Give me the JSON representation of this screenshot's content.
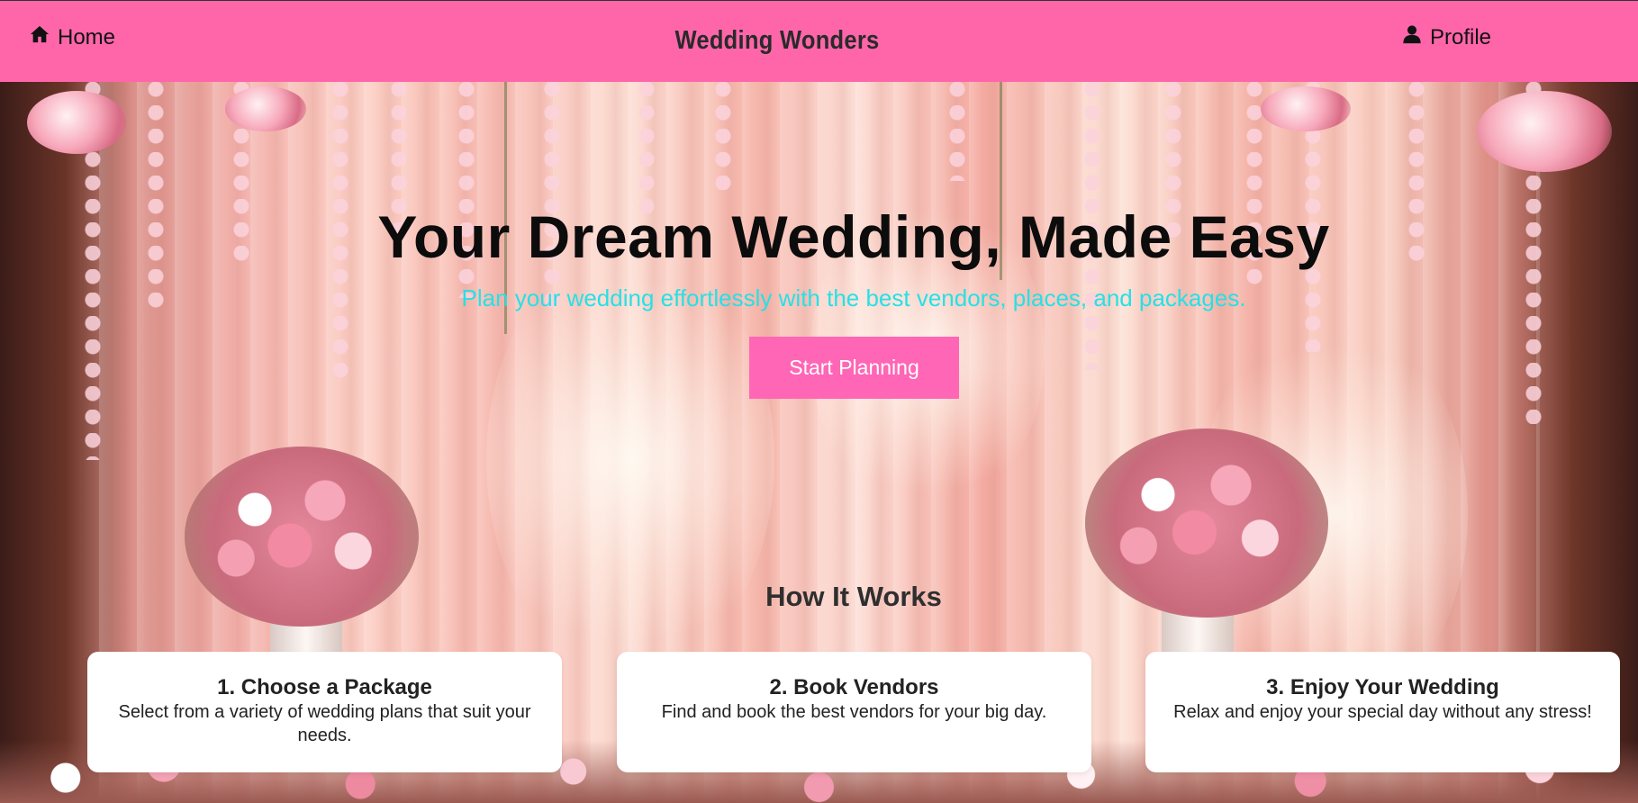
{
  "nav": {
    "home_label": "Home",
    "brand": "Wedding Wonders",
    "profile_label": "Profile"
  },
  "hero": {
    "title": "Your Dream Wedding, Made Easy",
    "subtitle": "Plan your wedding effortlessly with the best vendors, places, and packages.",
    "cta_label": "Start Planning"
  },
  "how_it_works": {
    "title": "How It Works",
    "steps": [
      {
        "title": "1. Choose a Package",
        "text": "Select from a variety of wedding plans that suit your needs."
      },
      {
        "title": "2. Book Vendors",
        "text": "Find and book the best vendors for your big day."
      },
      {
        "title": "3. Enjoy Your Wedding",
        "text": "Relax and enjoy your special day without any stress!"
      }
    ]
  },
  "colors": {
    "navbar": "#ff66aa",
    "cta": "#ff66b5",
    "subtitle": "#27e0e6"
  },
  "icons": {
    "home": "home-icon",
    "profile": "user-icon"
  }
}
